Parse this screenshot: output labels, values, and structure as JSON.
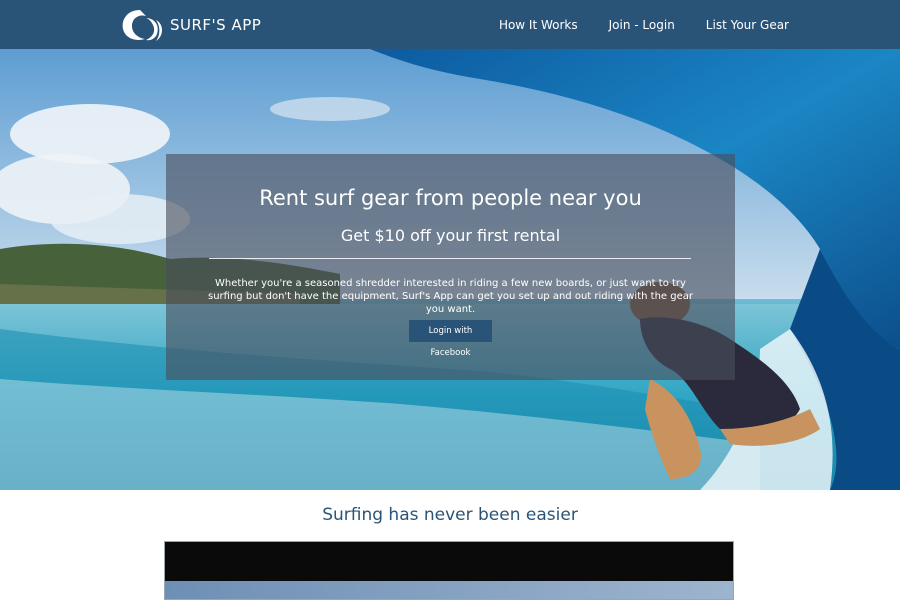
{
  "brand": {
    "name": "SURF'S APP",
    "logo_icon": "wave-logo-icon"
  },
  "nav": {
    "items": [
      {
        "label": "How It Works"
      },
      {
        "label": "Join - Login"
      },
      {
        "label": "List Your Gear"
      }
    ]
  },
  "hero": {
    "title": "Rent surf gear from people near you",
    "subtitle": "Get $10 off your first rental",
    "description": "Whether you're a seasoned shredder interested in riding a few new boards, or just want to try surfing but don't have the equipment, Surf's App can get you set up and out riding with the gear you want.",
    "cta_label": "Login with Facebook"
  },
  "section": {
    "title": "Surfing has never been easier"
  },
  "colors": {
    "primary": "#2a5477",
    "overlay": "#484e5c"
  }
}
